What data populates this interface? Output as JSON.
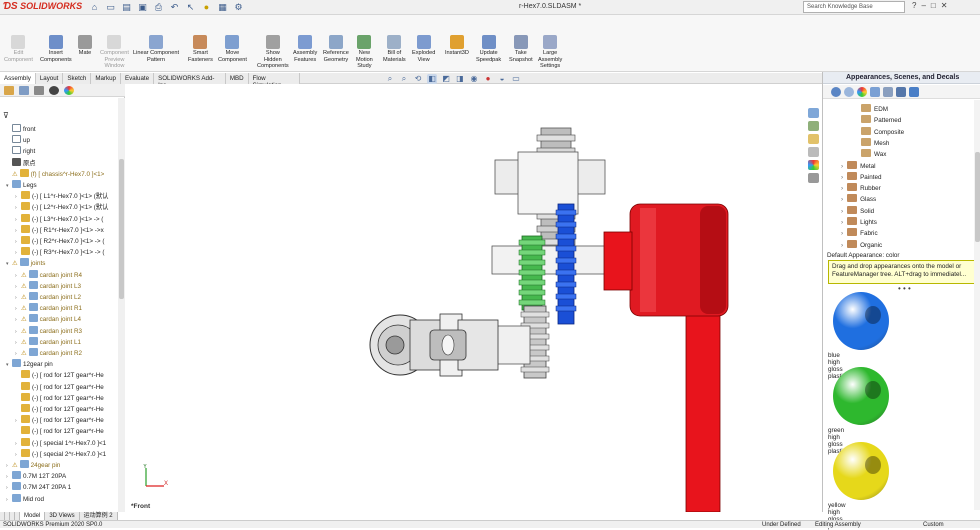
{
  "app": {
    "logo": "SOLIDWORKS",
    "window_title": "r-Hex7.0.SLDASM *",
    "search_placeholder": "Search Knowledge Base",
    "window_buttons": [
      "?",
      "–",
      "□",
      "✕"
    ]
  },
  "commands": [
    {
      "label": "Edit\nComponent",
      "disabled": true
    },
    {
      "label": "Insert\nComponents",
      "disabled": false
    },
    {
      "label": "Mate",
      "disabled": false
    },
    {
      "label": "Component\nPreview\nWindow",
      "disabled": true
    },
    {
      "label": "Linear Component\nPattern",
      "disabled": false
    },
    {
      "label": "Smart\nFasteners",
      "disabled": false
    },
    {
      "label": "Move\nComponent",
      "disabled": false
    },
    {
      "label": "Show\nHidden\nComponents",
      "disabled": false
    },
    {
      "label": "Assembly\nFeatures",
      "disabled": false
    },
    {
      "label": "Reference\nGeometry",
      "disabled": false
    },
    {
      "label": "New\nMotion\nStudy",
      "disabled": false
    },
    {
      "label": "Bill of\nMaterials",
      "disabled": false
    },
    {
      "label": "Exploded\nView",
      "disabled": false
    },
    {
      "label": "Instant3D",
      "disabled": false
    },
    {
      "label": "Update\nSpeedpak",
      "disabled": false
    },
    {
      "label": "Take\nSnapshot",
      "disabled": false
    },
    {
      "label": "Large\nAssembly\nSettings",
      "disabled": false
    }
  ],
  "tabs": [
    "Assembly",
    "Layout",
    "Sketch",
    "Markup",
    "Evaluate",
    "SOLIDWORKS Add-Ins",
    "MBD",
    "Flow Simulation"
  ],
  "active_tab": "Assembly",
  "tree": [
    {
      "label": "front",
      "icon": "plane",
      "level": 0,
      "arrow": ""
    },
    {
      "label": "up",
      "icon": "plane",
      "level": 0,
      "arrow": ""
    },
    {
      "label": "right",
      "icon": "plane",
      "level": 0,
      "arrow": ""
    },
    {
      "label": "原点",
      "icon": "origin",
      "level": 0,
      "arrow": ""
    },
    {
      "label": "(f) [ chassis^r-Hex7.0 ]<1>",
      "icon": "part",
      "level": 0,
      "arrow": "",
      "warn": true
    },
    {
      "label": "Legs",
      "icon": "folder",
      "level": 0,
      "arrow": "▾"
    },
    {
      "label": "(-) [ L1^r-Hex7.0 ]<1> (默认",
      "icon": "part",
      "level": 1,
      "arrow": "›"
    },
    {
      "label": "(-) [ L2^r-Hex7.0 ]<1> (默认",
      "icon": "part",
      "level": 1,
      "arrow": "›"
    },
    {
      "label": "(-) [ L3^r-Hex7.0 ]<1> -> (",
      "icon": "part",
      "level": 1,
      "arrow": "›"
    },
    {
      "label": "(-) [ R1^r-Hex7.0 ]<1> ->x",
      "icon": "part",
      "level": 1,
      "arrow": "›"
    },
    {
      "label": "(-) [ R2^r-Hex7.0 ]<1> -> (",
      "icon": "part",
      "level": 1,
      "arrow": "›"
    },
    {
      "label": "(-) [ R3^r-Hex7.0 ]<1> -> (",
      "icon": "part",
      "level": 1,
      "arrow": "›"
    },
    {
      "label": "joints",
      "icon": "folder",
      "level": 0,
      "arrow": "▾",
      "warn": true
    },
    {
      "label": "cardan joint R4",
      "icon": "folder",
      "level": 1,
      "arrow": "›",
      "warn": true
    },
    {
      "label": "cardan joint L3",
      "icon": "folder",
      "level": 1,
      "arrow": "›",
      "warn": true
    },
    {
      "label": "cardan joint L2",
      "icon": "folder",
      "level": 1,
      "arrow": "›",
      "warn": true
    },
    {
      "label": "cardan joint R1",
      "icon": "folder",
      "level": 1,
      "arrow": "›",
      "warn": true
    },
    {
      "label": "cardan joint L4",
      "icon": "folder",
      "level": 1,
      "arrow": "›",
      "warn": true
    },
    {
      "label": "cardan joint R3",
      "icon": "folder",
      "level": 1,
      "arrow": "›",
      "warn": true
    },
    {
      "label": "cardan joint L1",
      "icon": "folder",
      "level": 1,
      "arrow": "›",
      "warn": true
    },
    {
      "label": "cardan joint R2",
      "icon": "folder",
      "level": 1,
      "arrow": "›",
      "warn": true
    },
    {
      "label": "12gear pin",
      "icon": "folder",
      "level": 0,
      "arrow": "▾"
    },
    {
      "label": "(-) [ rod for 12T gear^r-He",
      "icon": "part",
      "level": 1,
      "arrow": ""
    },
    {
      "label": "(-) [ rod for 12T gear^r-He",
      "icon": "part",
      "level": 1,
      "arrow": ""
    },
    {
      "label": "(-) [ rod for 12T gear^r-He",
      "icon": "part",
      "level": 1,
      "arrow": ""
    },
    {
      "label": "(-) [ rod for 12T gear^r-He",
      "icon": "part",
      "level": 1,
      "arrow": ""
    },
    {
      "label": "(-) [ rod for 12T gear^r-He",
      "icon": "part",
      "level": 1,
      "arrow": "›"
    },
    {
      "label": "(-) [ rod for 12T gear^r-He",
      "icon": "part",
      "level": 1,
      "arrow": ""
    },
    {
      "label": "(-) [ special 1^r-Hex7.0 ]<1",
      "icon": "part",
      "level": 1,
      "arrow": "›"
    },
    {
      "label": "(-) [ sqecial 2^r-Hex7.0 ]<1",
      "icon": "part",
      "level": 1,
      "arrow": "›"
    },
    {
      "label": "24gear pin",
      "icon": "folder",
      "level": 0,
      "arrow": "›",
      "warn": true
    },
    {
      "label": "0.7M 12T 20PA",
      "icon": "folder",
      "level": 0,
      "arrow": "›"
    },
    {
      "label": "0.7M 24T 20PA 1",
      "icon": "folder",
      "level": 0,
      "arrow": "›"
    },
    {
      "label": "Mid rod",
      "icon": "folder",
      "level": 0,
      "arrow": "›"
    }
  ],
  "viewport": {
    "view_label": "*Front",
    "triad_y": "Y",
    "triad_x": "X"
  },
  "appearances": {
    "title": "Appearances, Scenes, and Decals",
    "items": [
      {
        "label": "EDM",
        "level": 1
      },
      {
        "label": "Patterned",
        "level": 1
      },
      {
        "label": "Composite",
        "level": 1
      },
      {
        "label": "Mesh",
        "level": 1
      },
      {
        "label": "Wax",
        "level": 1
      },
      {
        "label": "Metal",
        "level": 0
      },
      {
        "label": "Painted",
        "level": 0
      },
      {
        "label": "Rubber",
        "level": 0
      },
      {
        "label": "Glass",
        "level": 0
      },
      {
        "label": "Solid",
        "level": 0
      },
      {
        "label": "Lights",
        "level": 0
      },
      {
        "label": "Fabric",
        "level": 0
      },
      {
        "label": "Organic",
        "level": 0
      }
    ],
    "default_appearance": "Default Appearance: color",
    "hint": "Drag and drop appearances onto the model or FeatureManager tree.  ALT+drag to immediatel...",
    "swatches": [
      {
        "label": "blue high gloss plastic",
        "color": "#1f6fe0"
      },
      {
        "label": "green high gloss plastic",
        "color": "#2eb82e"
      },
      {
        "label": "yellow high gloss plastic",
        "color": "#e6d81a"
      }
    ]
  },
  "bottom_tabs": [
    "Model",
    "3D Views",
    "运动算例 2"
  ],
  "status": {
    "left": "SOLIDWORKS Premium 2020 SP0.0",
    "mid1": "Under Defined",
    "mid2": "Editing Assembly",
    "right": "Custom"
  },
  "colors": {
    "red_part": "#e8141c",
    "green_gear": "#3cb34a",
    "blue_gear": "#1a4fd6",
    "grey_gear": "#c8c8c8"
  }
}
